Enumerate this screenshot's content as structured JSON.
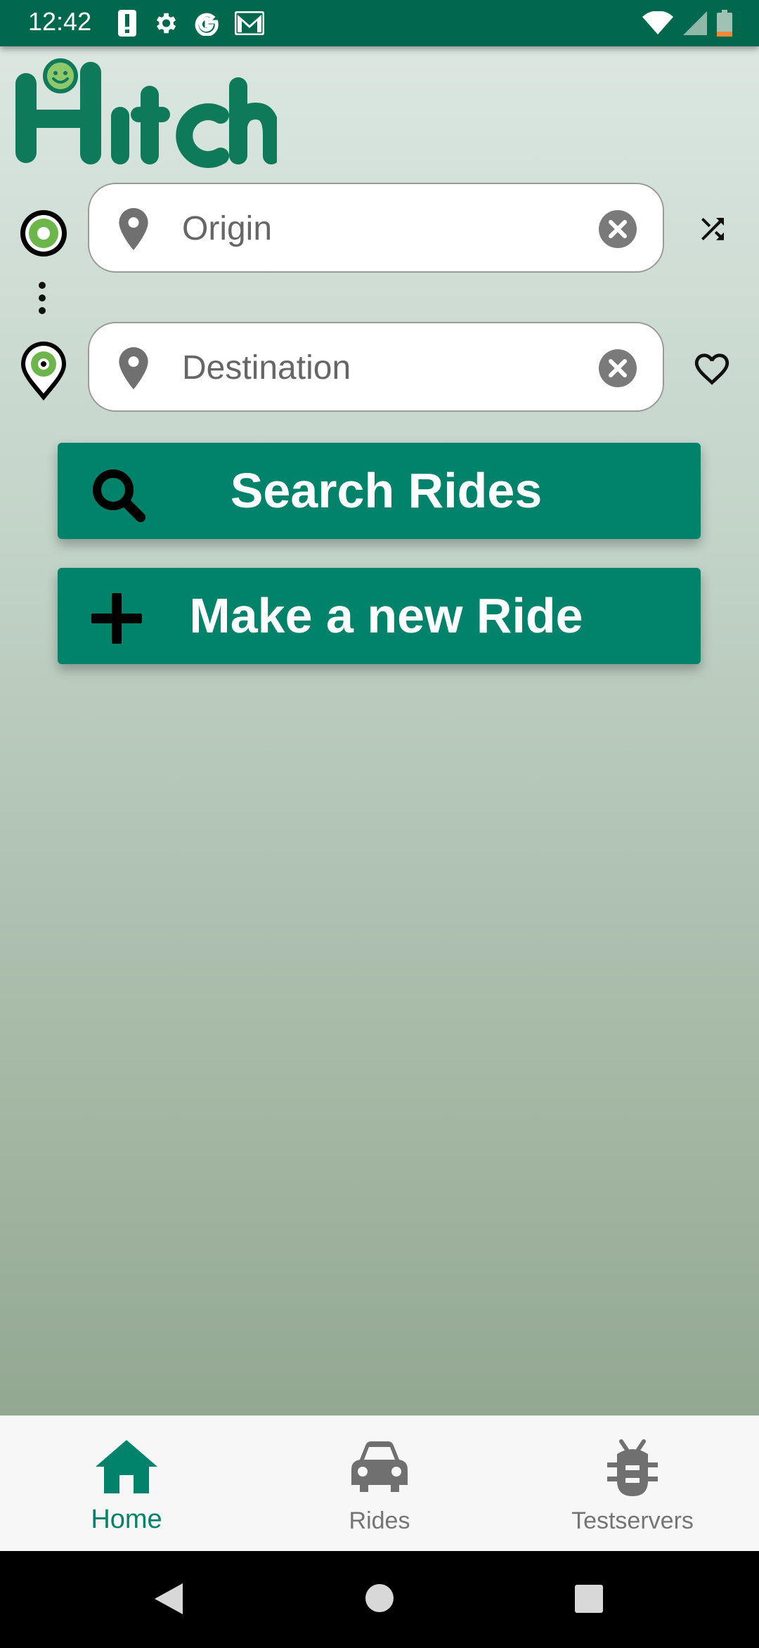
{
  "status_bar": {
    "time": "12:42",
    "left_icons": [
      "alert-icon",
      "settings-icon",
      "google-icon",
      "gmail-icon"
    ],
    "right_icons": [
      "wifi-icon",
      "cellular-icon",
      "battery-icon"
    ],
    "background": "#00694d"
  },
  "app": {
    "logo_text": "Hitch",
    "brand_color": "#00836a",
    "logo_color": "#0f7a59"
  },
  "search": {
    "origin": {
      "placeholder": "Origin",
      "value": ""
    },
    "destination": {
      "placeholder": "Destination",
      "value": ""
    },
    "swap_icon": "shuffle-icon",
    "favorite_icon": "heart-outline-icon"
  },
  "actions": {
    "search_label": "Search Rides",
    "new_ride_label": "Make a new Ride"
  },
  "bottom_nav": {
    "items": [
      {
        "label": "Home",
        "icon": "home-icon",
        "active": true
      },
      {
        "label": "Rides",
        "icon": "car-icon",
        "active": false
      },
      {
        "label": "Testservers",
        "icon": "bug-icon",
        "active": false
      }
    ]
  },
  "system_nav": {
    "icons": [
      "back-icon",
      "home-circle-icon",
      "recents-icon"
    ]
  }
}
